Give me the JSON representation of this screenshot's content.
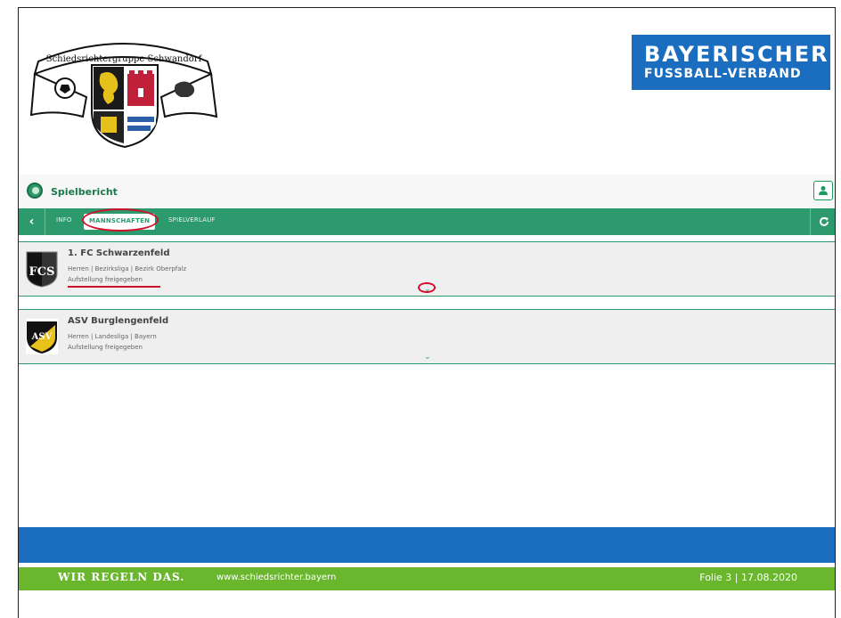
{
  "logo": {
    "text": "Schiedsrichtergruppe Schwandorf"
  },
  "bfv": {
    "line1": "BAYERISCHER",
    "line2": "FUSSBALL-VERBAND"
  },
  "app": {
    "title": "Spielbericht"
  },
  "tabs": [
    {
      "label": "INFO"
    },
    {
      "label": "MANNSCHAFTEN",
      "active": true
    },
    {
      "label": "SPIELVERLAUF"
    }
  ],
  "teams": [
    {
      "name": "1. FC Schwarzenfeld",
      "meta": "Herren | Bezirksliga | Bezirk Oberpfalz",
      "status": "Aufstellung freigegeben",
      "badge_text": "FCS"
    },
    {
      "name": "ASV Burglengenfeld",
      "meta": "Herren | Landesliga | Bayern",
      "status": "Aufstellung freigegeben",
      "badge_text": "ASV"
    }
  ],
  "footer": {
    "slogan": "WIR REGELN DAS.",
    "website": "www.schiedsrichter.bayern",
    "slide": "Folie 3 |  17.08.2020"
  },
  "colors": {
    "accent_green": "#2c9a6c",
    "bfv_blue": "#1a6dbf",
    "footer_green": "#6ab72e",
    "annotation_red": "#d0102a"
  }
}
